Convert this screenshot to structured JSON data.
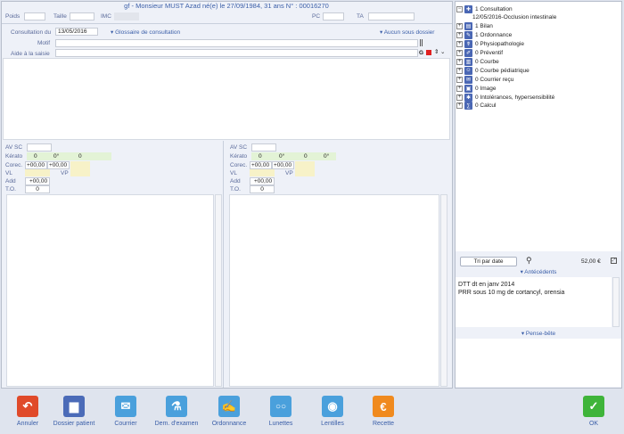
{
  "header": {
    "title": "gf - Monsieur MUST Azad   né(e) le 27/09/1984, 31 ans   N° : 00016270",
    "poids_label": "Poids",
    "taille_label": "Taille",
    "imc_label": "IMC",
    "pc_label": "PC",
    "ta_label": "TA"
  },
  "consultation": {
    "date_label": "Consultation du",
    "date_value": "13/05/2016",
    "glossary_label": "Glossaire de consultation",
    "subfolder_label": "Aucun sous dossier",
    "motif_label": "Motif",
    "aide_label": "Aide à la saisie",
    "g_label": "G"
  },
  "eye_left": {
    "av_sc": "AV SC",
    "kerato": "Kérato",
    "kerato_v1": "0",
    "kerato_v2": "0°",
    "kerato_v3": "0",
    "correc": "Corec.",
    "correc_v1": "+00,00",
    "correc_v2": "+00,00",
    "vl": "VL",
    "vp": "VP",
    "add": "Add",
    "add_v": "+00,00",
    "to": "T.O.",
    "to_v": "0"
  },
  "eye_right": {
    "av_sc": "AV SC",
    "kerato": "Kérato",
    "kerato_v1": "0",
    "kerato_v2": "0°",
    "kerato_v3": "0",
    "kerato_v4": "0°",
    "correc": "Corec.",
    "correc_v1": "+00,00",
    "correc_v2": "+00,00",
    "vl": "VL",
    "vp": "VP",
    "add": "Add",
    "add_v": "+00,00",
    "to": "T.O.",
    "to_v": "0"
  },
  "tree": {
    "items": [
      {
        "label": "1 Consultation",
        "toggle": "−",
        "icon": "consultation-icon",
        "glyph": "✚"
      },
      {
        "label": "12/05/2016-Occlusion intestinale",
        "child": true
      },
      {
        "label": "1 Bilan",
        "toggle": "+",
        "icon": "bilan-icon",
        "glyph": "▤"
      },
      {
        "label": "1 Ordonnance",
        "toggle": "+",
        "icon": "ordonnance-icon",
        "glyph": "✎"
      },
      {
        "label": "0 Physiopathologie",
        "toggle": "+",
        "icon": "physiopathologie-icon",
        "glyph": "☤"
      },
      {
        "label": "0 Préventif",
        "toggle": "+",
        "icon": "preventif-icon",
        "glyph": "✐"
      },
      {
        "label": "0 Courbe",
        "toggle": "+",
        "icon": "courbe-icon",
        "glyph": "▥"
      },
      {
        "label": "0 Courbe pédiatrique",
        "toggle": "+",
        "icon": "courbe-pediatrique-icon",
        "glyph": "☺"
      },
      {
        "label": "0 Courrier reçu",
        "toggle": "+",
        "icon": "courrier-recu-icon",
        "glyph": "✉"
      },
      {
        "label": "0 Image",
        "toggle": "+",
        "icon": "image-icon",
        "glyph": "▣"
      },
      {
        "label": "0 Intolérances, hypersensibilité",
        "toggle": "+",
        "icon": "intolerances-icon",
        "glyph": "✱"
      },
      {
        "label": "0 Calcul",
        "toggle": "+",
        "icon": "calcul-icon",
        "glyph": "∑"
      }
    ]
  },
  "right_panel": {
    "sort_button": "Tri par date",
    "amount": "52,00 €",
    "antecedents_label": "Antécédents",
    "antecedents_lines": [
      "DTT dt en janv 2014",
      "PRR sous 10 mg de cortancyl, orensia"
    ],
    "pense_bete_label": "Pense-bête"
  },
  "toolbar": {
    "annuler": "Annuler",
    "dossier": "Dossier patient",
    "courrier": "Courrier",
    "dem_examen": "Dem. d'examen",
    "ordonnance": "Ordonnance",
    "lunettes": "Lunettes",
    "lentilles": "Lentilles",
    "recette": "Recette",
    "ok": "OK"
  },
  "colors": {
    "annuler": "#e04a2a",
    "dossier": "#4b6bb8",
    "courrier": "#4aa0dc",
    "dem_examen": "#4aa0dc",
    "ordonnance": "#4aa0dc",
    "lunettes": "#4aa0dc",
    "lentilles": "#4aa0dc",
    "recette": "#f08a1e",
    "ok": "#3fb43a"
  }
}
